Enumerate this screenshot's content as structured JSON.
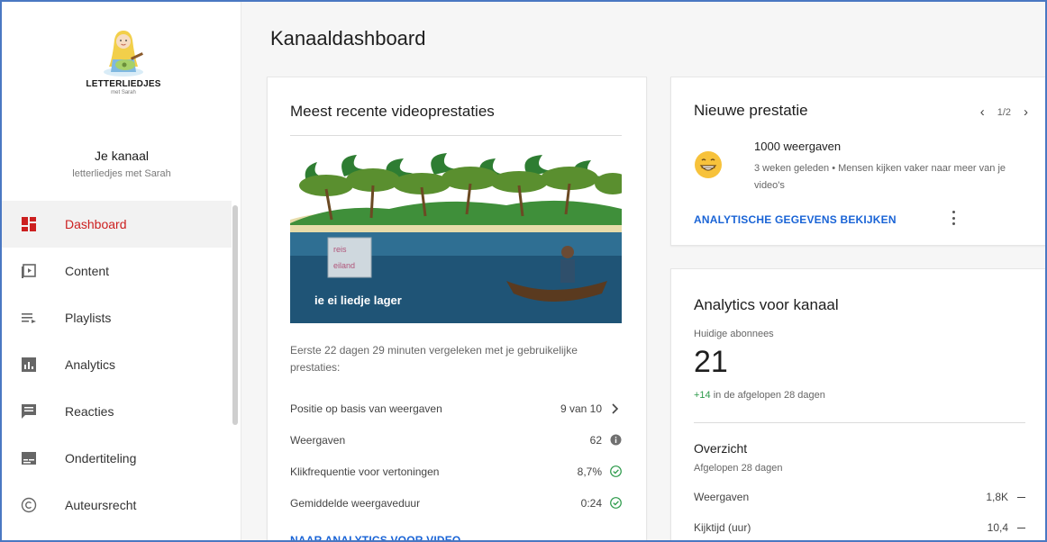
{
  "brand": {
    "name": "LETTERLIEDJES",
    "tagline": "met Sarah"
  },
  "channel": {
    "title": "Je kanaal",
    "handle": "letterliedjes met Sarah"
  },
  "nav": {
    "items": [
      {
        "label": "Dashboard",
        "icon": "dashboard-icon",
        "active": true
      },
      {
        "label": "Content",
        "icon": "content-icon"
      },
      {
        "label": "Playlists",
        "icon": "playlist-icon"
      },
      {
        "label": "Analytics",
        "icon": "analytics-icon"
      },
      {
        "label": "Reacties",
        "icon": "comments-icon"
      },
      {
        "label": "Ondertiteling",
        "icon": "subtitles-icon"
      },
      {
        "label": "Auteursrecht",
        "icon": "copyright-icon"
      }
    ]
  },
  "page": {
    "title": "Kanaaldashboard"
  },
  "recent_video": {
    "title": "Meest recente videoprestaties",
    "thumbnail_caption": "ie ei liedje lager",
    "thumbnail_sign_line1": "reis",
    "thumbnail_sign_line2": "eiland",
    "comparison": "Eerste 22 dagen 29 minuten vergeleken met je gebruikelijke prestaties:",
    "metrics": [
      {
        "label": "Positie op basis van weergaven",
        "value": "9 van 10",
        "icon": "chevron-right-icon"
      },
      {
        "label": "Weergaven",
        "value": "62",
        "icon": "info-icon"
      },
      {
        "label": "Klikfrequentie voor vertoningen",
        "value": "8,7%",
        "icon": "check-circle-icon"
      },
      {
        "label": "Gemiddelde weergaveduur",
        "value": "0:24",
        "icon": "check-circle-icon"
      }
    ],
    "link": "NAAR ANALYTICS VOOR VIDEO"
  },
  "achievement": {
    "title": "Nieuwe prestatie",
    "pager": "1/2",
    "headline": "1000 weergaven",
    "description": "3 weken geleden • Mensen kijken vaker naar meer van je video's",
    "link": "ANALYTISCHE GEGEVENS BEKIJKEN"
  },
  "channel_analytics": {
    "title": "Analytics voor kanaal",
    "subscribers_label": "Huidige abonnees",
    "subscribers": "21",
    "delta": "+14",
    "delta_suffix": " in de afgelopen 28 dagen",
    "overview_title": "Overzicht",
    "overview_sub": "Afgelopen 28 dagen",
    "rows": [
      {
        "label": "Weergaven",
        "value": "1,8K"
      },
      {
        "label": "Kijktijd (uur)",
        "value": "10,4"
      }
    ]
  },
  "colors": {
    "accent_red": "#cc1f1f",
    "link_blue": "#1a64d6",
    "positive_green": "#2c9a4a"
  }
}
